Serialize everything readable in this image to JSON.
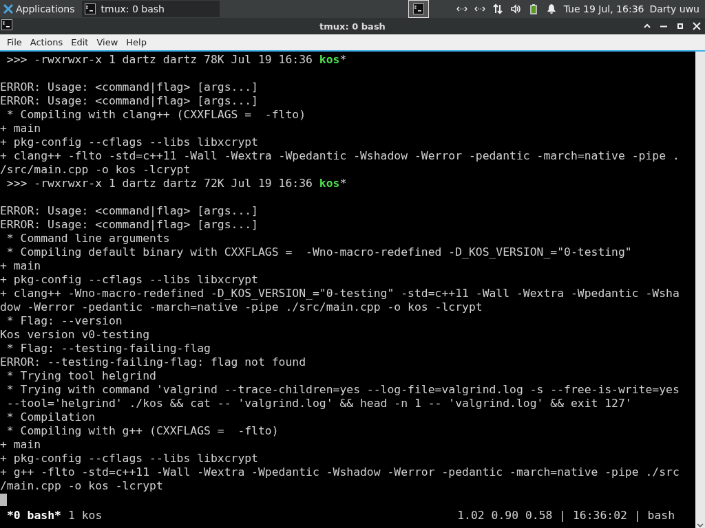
{
  "panel": {
    "apps_label": "Applications",
    "tasks": [
      {
        "label": "tmux: 0 bash",
        "selected": true
      }
    ],
    "clock": "Tue 19 Jul, 16:36",
    "user": "Darty uwu"
  },
  "window": {
    "title": "tmux: 0 bash"
  },
  "menu": [
    "File",
    "Actions",
    "Edit",
    "View",
    "Help"
  ],
  "terminal": {
    "lines": [
      {
        "kind": "ls",
        "text": " >>> -rwxrwxr-x 1 dartz dartz 78K Jul 19 16:36 ",
        "file": "kos",
        "suffix": "*"
      },
      {
        "kind": "blank"
      },
      {
        "kind": "text",
        "text": "ERROR: Usage: <command|flag> [args...]"
      },
      {
        "kind": "text",
        "text": "ERROR: Usage: <command|flag> [args...]"
      },
      {
        "kind": "text",
        "text": " * Compiling with clang++ (CXXFLAGS =  -flto)"
      },
      {
        "kind": "text",
        "text": "+ main"
      },
      {
        "kind": "text",
        "text": "+ pkg-config --cflags --libs libxcrypt"
      },
      {
        "kind": "text",
        "text": "+ clang++ -flto -std=c++11 -Wall -Wextra -Wpedantic -Wshadow -Werror -pedantic -march=native -pipe ."
      },
      {
        "kind": "text",
        "text": "/src/main.cpp -o kos -lcrypt"
      },
      {
        "kind": "ls",
        "text": " >>> -rwxrwxr-x 1 dartz dartz 72K Jul 19 16:36 ",
        "file": "kos",
        "suffix": "*"
      },
      {
        "kind": "blank"
      },
      {
        "kind": "text",
        "text": "ERROR: Usage: <command|flag> [args...]"
      },
      {
        "kind": "text",
        "text": "ERROR: Usage: <command|flag> [args...]"
      },
      {
        "kind": "text",
        "text": " * Command line arguments"
      },
      {
        "kind": "text",
        "text": " * Compiling default binary with CXXFLAGS =  -Wno-macro-redefined -D_KOS_VERSION_=\"0-testing\""
      },
      {
        "kind": "text",
        "text": "+ main"
      },
      {
        "kind": "text",
        "text": "+ pkg-config --cflags --libs libxcrypt"
      },
      {
        "kind": "text",
        "text": "+ clang++ -Wno-macro-redefined -D_KOS_VERSION_=\"0-testing\" -std=c++11 -Wall -Wextra -Wpedantic -Wsha"
      },
      {
        "kind": "text",
        "text": "dow -Werror -pedantic -march=native -pipe ./src/main.cpp -o kos -lcrypt"
      },
      {
        "kind": "text",
        "text": " * Flag: --version"
      },
      {
        "kind": "text",
        "text": "Kos version v0-testing"
      },
      {
        "kind": "text",
        "text": " * Flag: --testing-failing-flag"
      },
      {
        "kind": "text",
        "text": "ERROR: --testing-failing-flag: flag not found"
      },
      {
        "kind": "text",
        "text": " * Trying tool helgrind"
      },
      {
        "kind": "text",
        "text": " * Trying with command 'valgrind --trace-children=yes --log-file=valgrind.log -s --free-is-write=yes"
      },
      {
        "kind": "text",
        "text": " --tool='helgrind' ./kos && cat -- 'valgrind.log' && head -n 1 -- 'valgrind.log' && exit 127'"
      },
      {
        "kind": "text",
        "text": " * Compilation"
      },
      {
        "kind": "text",
        "text": " * Compiling with g++ (CXXFLAGS =  -flto)"
      },
      {
        "kind": "text",
        "text": "+ main"
      },
      {
        "kind": "text",
        "text": "+ pkg-config --cflags --libs libxcrypt"
      },
      {
        "kind": "text",
        "text": "+ g++ -flto -std=c++11 -Wall -Wextra -Wpedantic -Wshadow -Werror -pedantic -march=native -pipe ./src"
      },
      {
        "kind": "text",
        "text": "/main.cpp -o kos -lcrypt"
      },
      {
        "kind": "cursor"
      }
    ]
  },
  "tmux_status": {
    "windows": [
      {
        "label": "*0 bash*",
        "selected": true
      },
      {
        "label": "1 kos",
        "selected": false
      }
    ],
    "right": "1.02 0.90 0.58 | 16:36:02 | bash"
  }
}
